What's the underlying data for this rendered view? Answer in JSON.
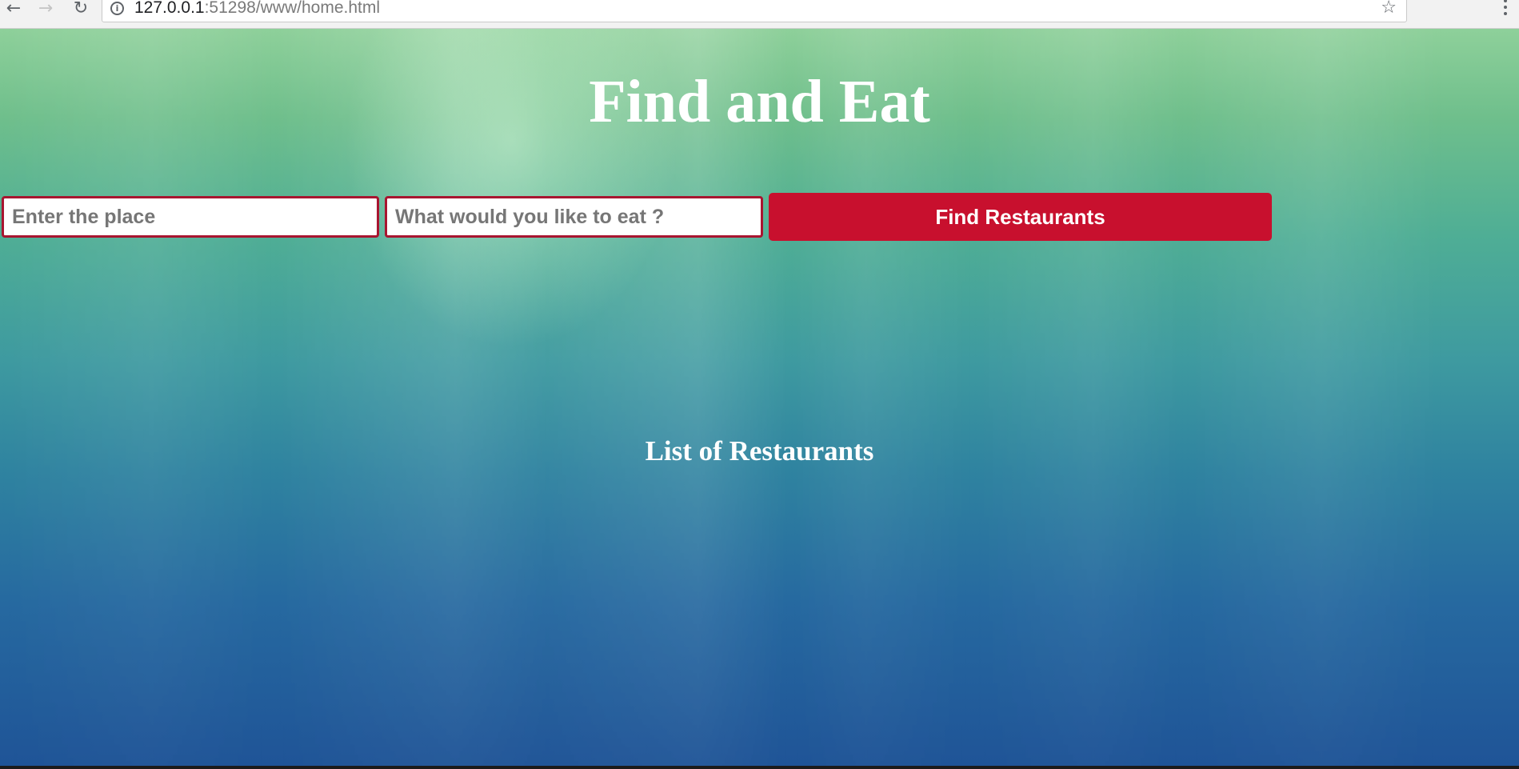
{
  "browser": {
    "url_host": "127.0.0.1",
    "url_rest": ":51298/www/home.html",
    "icons": {
      "back": "back-arrow-icon",
      "forward": "forward-arrow-icon",
      "reload": "reload-icon",
      "info": "info-icon",
      "bookmark": "star-icon",
      "menu": "kebab-menu-icon"
    }
  },
  "page": {
    "title": "Find and Eat",
    "search": {
      "place_placeholder": "Enter the place",
      "place_value": "",
      "food_placeholder": "What would you like to eat ?",
      "food_value": "",
      "button_label": "Find Restaurants"
    },
    "list_heading": "List of Restaurants",
    "restaurants": []
  },
  "colors": {
    "accent": "#c8102e",
    "input_border": "#a81530",
    "background_top": "#8ed09a",
    "background_bottom": "#1f5497",
    "heading_text": "#ffffff"
  }
}
